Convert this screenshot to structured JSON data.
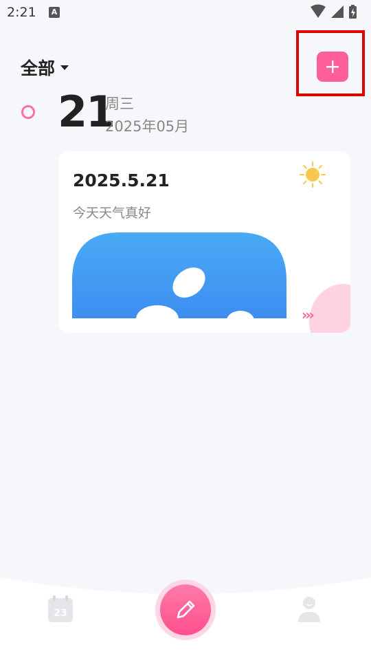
{
  "status_bar": {
    "time": "2:21",
    "notification_badge": "A"
  },
  "header": {
    "filter_label": "全部"
  },
  "date": {
    "day": "21",
    "weekday": "周三",
    "year_month": "2025年05月"
  },
  "entry": {
    "date": "2025.5.21",
    "text": "今天天气真好",
    "weather_icon": "sun-icon",
    "more_arrows": "›››"
  },
  "bottom_nav": {
    "calendar_day": "23"
  },
  "colors": {
    "accent": "#ff5f98",
    "highlight": "#e00000",
    "background": "#f6f7fa"
  }
}
